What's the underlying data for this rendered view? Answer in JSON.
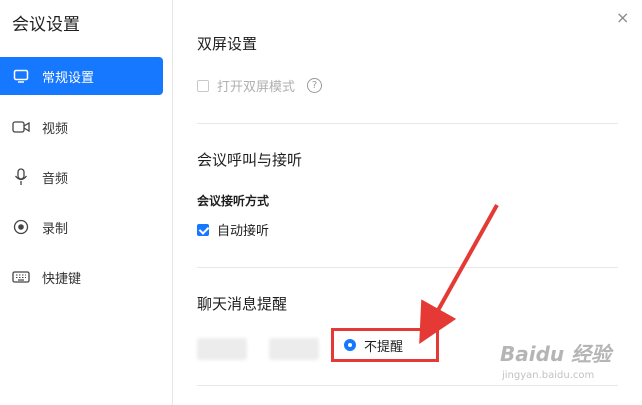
{
  "window": {
    "title": "会议设置",
    "close_glyph": "×"
  },
  "sidebar": {
    "items": [
      {
        "label": "常规设置",
        "icon": "monitor-icon",
        "active": true
      },
      {
        "label": "视频",
        "icon": "video-camera-icon",
        "active": false
      },
      {
        "label": "音频",
        "icon": "microphone-icon",
        "active": false
      },
      {
        "label": "录制",
        "icon": "record-icon",
        "active": false
      },
      {
        "label": "快捷键",
        "icon": "keyboard-icon",
        "active": false
      }
    ]
  },
  "main": {
    "dual_screen": {
      "title": "双屏设置",
      "option_label": "打开双屏模式",
      "help_glyph": "?"
    },
    "meeting_call": {
      "title": "会议呼叫与接听",
      "sublabel": "会议接听方式",
      "option_label": "自动接听"
    },
    "chat_notify": {
      "title": "聊天消息提醒",
      "radio_label": "不提醒"
    }
  },
  "watermark": {
    "text": "Baidu 经验",
    "url_text": "jingyan.baidu.com"
  },
  "colors": {
    "accent": "#1677ff",
    "highlight_red": "#e53935"
  }
}
